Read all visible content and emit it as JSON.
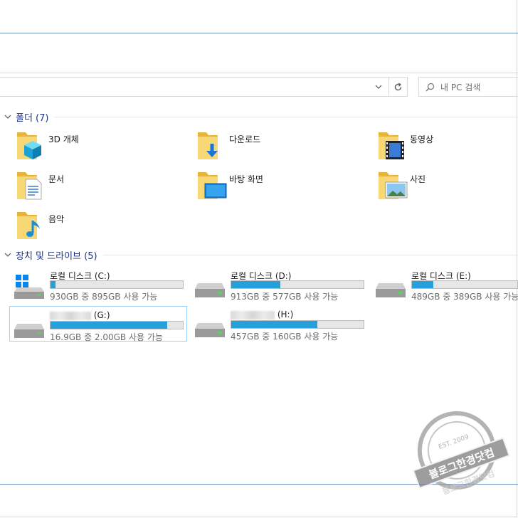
{
  "search": {
    "placeholder": "내 PC 검색"
  },
  "groups": {
    "folders": {
      "title": "폴더 (7)"
    },
    "devices": {
      "title": "장치 및 드라이브 (5)"
    }
  },
  "folders": [
    {
      "label": "3D 개체",
      "icon": "3d-objects-folder-icon"
    },
    {
      "label": "다운로드",
      "icon": "downloads-folder-icon"
    },
    {
      "label": "동영상",
      "icon": "videos-folder-icon"
    },
    {
      "label": "문서",
      "icon": "documents-folder-icon"
    },
    {
      "label": "바탕 화면",
      "icon": "desktop-folder-icon"
    },
    {
      "label": "사진",
      "icon": "pictures-folder-icon"
    },
    {
      "label": "음악",
      "icon": "music-folder-icon"
    }
  ],
  "drives": [
    {
      "name": "로컬 디스크 (C:)",
      "free_text": "930GB 중 895GB 사용 가능",
      "used_fraction": 0.04,
      "icon": "windows-drive-icon"
    },
    {
      "name": "로컬 디스크 (D:)",
      "free_text": "913GB 중 577GB 사용 가능",
      "used_fraction": 0.37,
      "icon": "hard-drive-icon"
    },
    {
      "name": "로컬 디스크 (E:)",
      "free_text": "489GB 중 389GB 사용 가능",
      "used_fraction": 0.2,
      "icon": "hard-drive-icon"
    },
    {
      "name": "(G:)",
      "free_text": "16.9GB 중 2.00GB 사용 가능",
      "used_fraction": 0.88,
      "icon": "hard-drive-icon"
    },
    {
      "name": "(H:)",
      "free_text": "457GB 중 160GB 사용 가능",
      "used_fraction": 0.65,
      "icon": "hard-drive-icon"
    }
  ],
  "watermark": {
    "main": "블로그한경닷컴",
    "sub": "EST. 2009",
    "ring": "http://blog.hankyung.com",
    "reflection": "블로그한경닷컴"
  },
  "colors": {
    "accent": "#26a0da",
    "header": "#1e3287",
    "ribbon_line": "#6c8fbd"
  }
}
